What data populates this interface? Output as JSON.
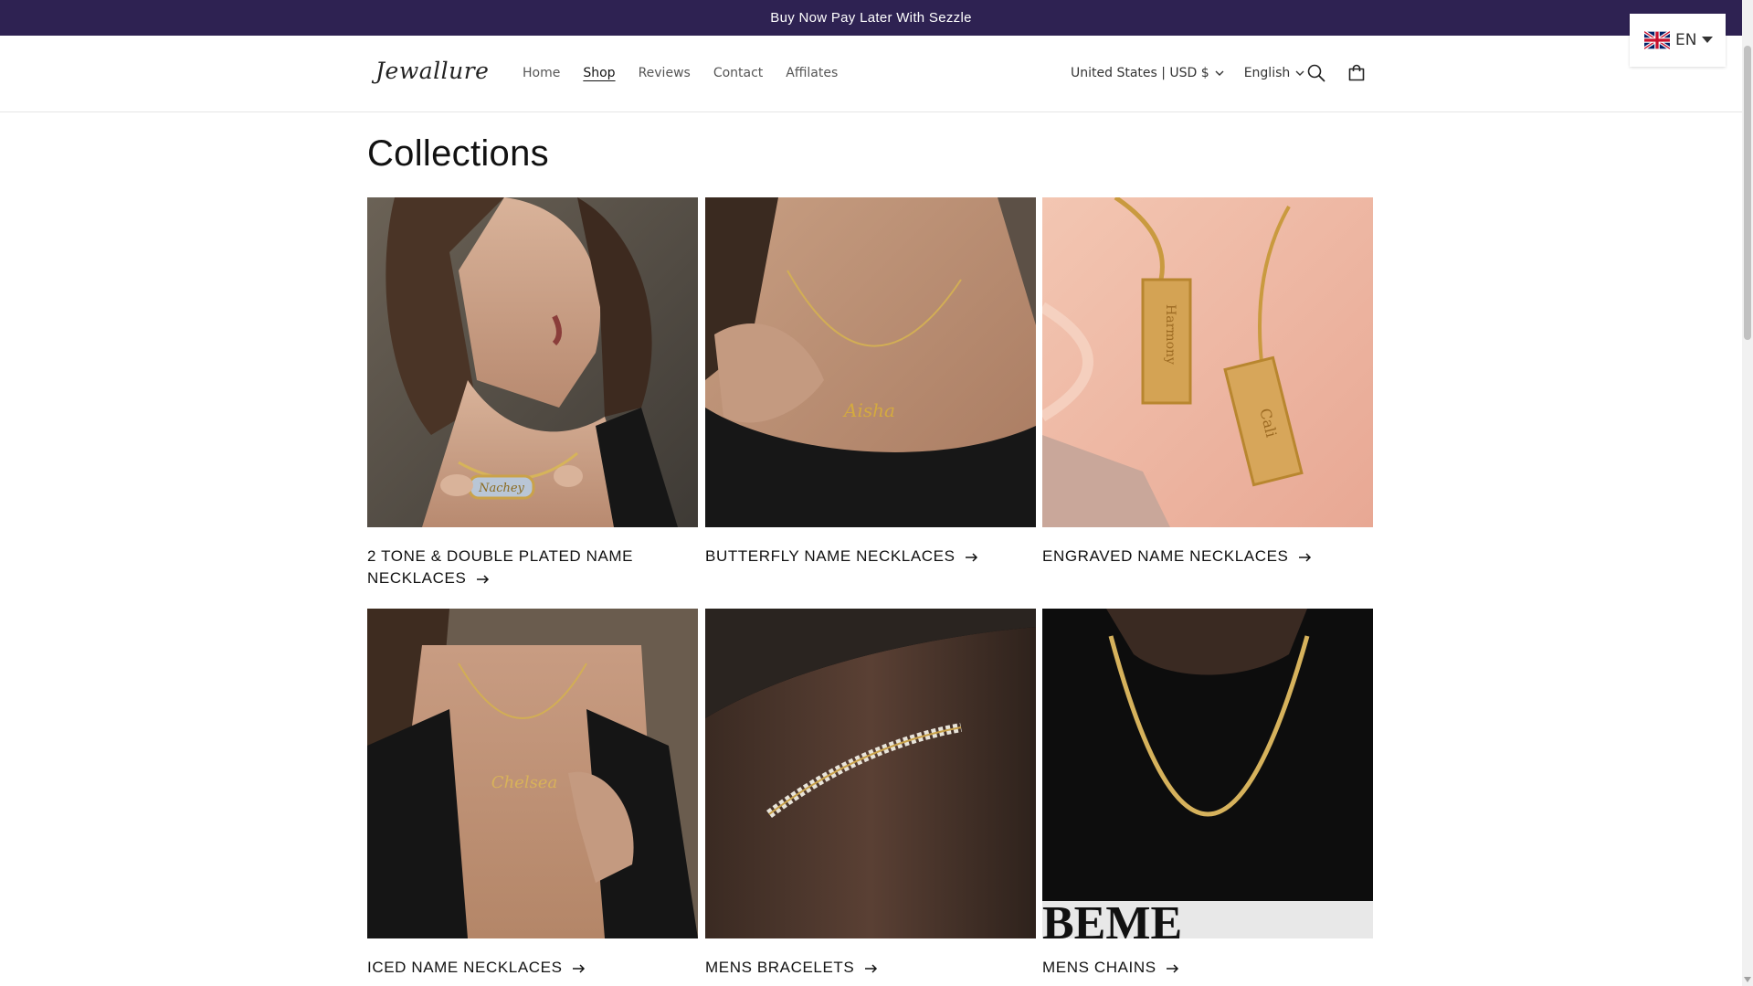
{
  "announcement": "Buy Now Pay Later With Sezzle",
  "brand": "Jewallure",
  "nav": [
    {
      "label": "Home",
      "active": false
    },
    {
      "label": "Shop",
      "active": true
    },
    {
      "label": "Reviews",
      "active": false
    },
    {
      "label": "Contact",
      "active": false
    },
    {
      "label": "Affilates",
      "active": false
    }
  ],
  "localization": {
    "country": "United States | USD $",
    "language": "English"
  },
  "lang_widget": {
    "code": "EN"
  },
  "page_title": "Collections",
  "collections": [
    {
      "title": "2 TONE & DOUBLE PLATED NAME NECKLACES",
      "image_text": "Nachey"
    },
    {
      "title": "BUTTERFLY NAME NECKLACES",
      "image_text": "Aisha"
    },
    {
      "title": "ENGRAVED NAME NECKLACES",
      "image_text": "Harmony"
    },
    {
      "title": "ICED NAME NECKLACES",
      "image_text": "Chelsea"
    },
    {
      "title": "MENS BRACELETS",
      "image_text": ""
    },
    {
      "title": "MENS CHAINS",
      "image_text": "BEME"
    }
  ],
  "engraved_second_tag": "Cali",
  "icons": [
    "search-icon",
    "cart-icon",
    "chevron-down-icon",
    "arrow-right-icon",
    "uk-flag-icon"
  ],
  "colors": {
    "announcement_bg": "#2e2252",
    "text": "#121212",
    "nav_text": "#555555"
  }
}
